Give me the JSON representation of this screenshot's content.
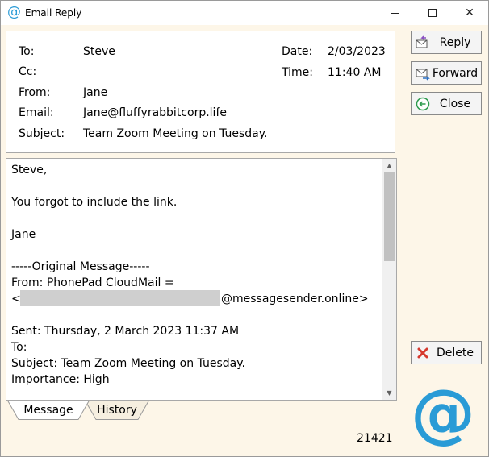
{
  "window": {
    "title": "Email Reply",
    "app_icon": "at-sign-icon",
    "minimize_glyph": "minimize",
    "maximize_glyph": "maximize",
    "close_glyph": "✕"
  },
  "header": {
    "to_label": "To:",
    "to_value": "Steve",
    "cc_label": "Cc:",
    "cc_value": "",
    "from_label": "From:",
    "from_value": "Jane",
    "email_label": "Email:",
    "email_value": "Jane@fluffyrabbitcorp.life",
    "subject_label": "Subject:",
    "subject_value": "Team Zoom Meeting on Tuesday.",
    "date_label": "Date:",
    "date_value": "2/03/2023",
    "time_label": "Time:",
    "time_value": "11:40 AM"
  },
  "message_lines": [
    "Steve,",
    "",
    "You forgot to include the link.",
    "",
    "Jane",
    "",
    "-----Original Message-----",
    "From: PhonePad CloudMail =",
    "<",
    "",
    "Sent: Thursday, 2 March 2023 11:37 AM",
    "To:",
    "Subject: Team Zoom Meeting on Tuesday.",
    "Importance: High"
  ],
  "redacted_suffix": "@messagesender.online>",
  "buttons": {
    "reply": "Reply",
    "forward": "Forward",
    "close": "Close",
    "delete": "Delete"
  },
  "tabs": [
    {
      "label": "Message",
      "active": true
    },
    {
      "label": "History",
      "active": false
    }
  ],
  "logo": "@",
  "record_count": "21421",
  "colors": {
    "accent": "#2a9bd6",
    "window_bg": "#fdf6e8",
    "delete_red": "#d63a2f",
    "close_green": "#2e9b4e"
  }
}
